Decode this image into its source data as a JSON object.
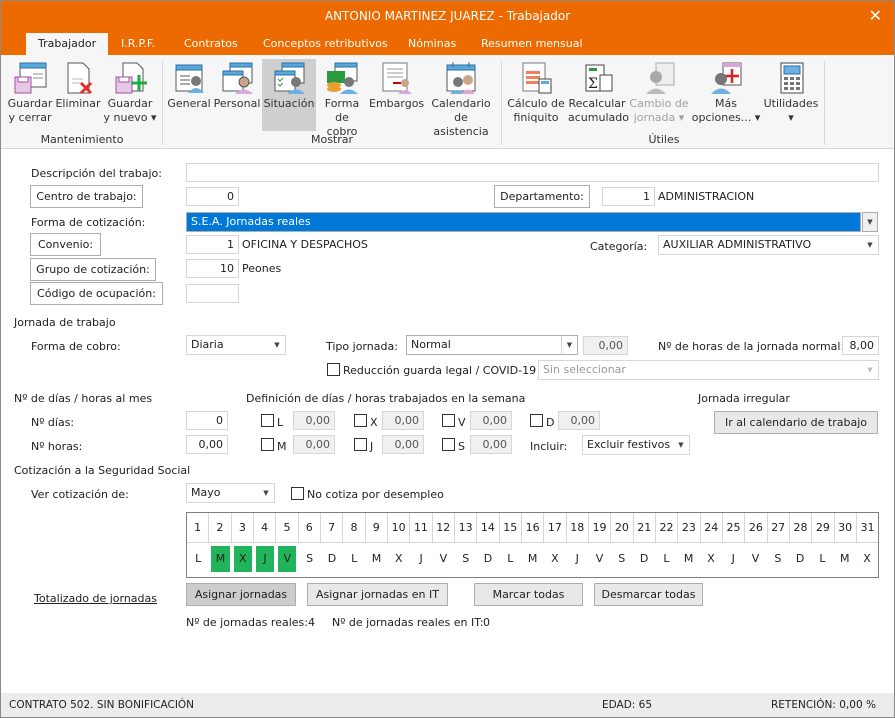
{
  "window": {
    "title": "ANTONIO MARTINEZ JUAREZ - Trabajador",
    "close_glyph": "✕"
  },
  "tabs": [
    {
      "label": "Trabajador",
      "active": true
    },
    {
      "label": "I.R.P.F."
    },
    {
      "label": "Contratos"
    },
    {
      "label": "Conceptos retributivos"
    },
    {
      "label": "Nóminas"
    },
    {
      "label": "Resumen mensual"
    }
  ],
  "ribbon": {
    "groups": {
      "mantenimiento": "Mantenimiento",
      "mostrar": "Mostrar",
      "utiles": "Útiles"
    },
    "buttons": {
      "guardar_cerrar": {
        "l1": "Guardar",
        "l2": "y cerrar",
        "icon": "save-close-icon"
      },
      "eliminar": {
        "l1": "Eliminar",
        "l2": "",
        "icon": "delete-icon"
      },
      "guardar_nuevo": {
        "l1": "Guardar",
        "l2": "y nuevo ▾",
        "icon": "save-new-icon"
      },
      "general": {
        "l1": "General",
        "l2": "",
        "icon": "general-icon"
      },
      "personal": {
        "l1": "Personal",
        "l2": "",
        "icon": "personal-icon"
      },
      "situacion": {
        "l1": "Situación",
        "l2": "",
        "icon": "situacion-icon",
        "selected": true
      },
      "forma_cobro": {
        "l1": "Forma",
        "l2": "de cobro",
        "icon": "payment-icon"
      },
      "embargos": {
        "l1": "Embargos",
        "l2": "",
        "icon": "embargos-icon"
      },
      "calendario": {
        "l1": "Calendario",
        "l2": "de asistencia",
        "icon": "calendar-icon"
      },
      "finiquito": {
        "l1": "Cálculo de",
        "l2": "finiquito",
        "icon": "finiquito-icon"
      },
      "recalcular": {
        "l1": "Recalcular",
        "l2": "acumulado",
        "icon": "sigma-icon"
      },
      "cambio_jornada": {
        "l1": "Cambio de",
        "l2": "jornada ▾",
        "icon": "cambio-jornada-icon",
        "disabled": true
      },
      "mas_opciones": {
        "l1": "Más",
        "l2": "opciones... ▾",
        "icon": "more-options-icon"
      },
      "utilidades": {
        "l1": "Utilidades",
        "l2": "▾",
        "icon": "calculator-icon"
      }
    }
  },
  "form": {
    "descripcion_label": "Descripción del trabajo:",
    "descripcion_value": "",
    "centro_btn": "Centro de trabajo:",
    "centro_value": "0",
    "departamento_btn": "Departamento:",
    "departamento_code": "1",
    "departamento_name": "ADMINISTRACION",
    "forma_cotizacion_label": "Forma de cotización:",
    "forma_cotizacion_value": "S.E.A. Jornadas reales",
    "convenio_btn": "Convenio:",
    "convenio_code": "1",
    "convenio_name": "OFICINA Y DESPACHOS",
    "categoria_label": "Categoría:",
    "categoria_value": "AUXILIAR ADMINISTRATIVO",
    "grupo_btn": "Grupo de cotización:",
    "grupo_code": "10",
    "grupo_name": "Peones",
    "codigo_btn": "Código de ocupación:",
    "codigo_value": ""
  },
  "jornada": {
    "section_title": "Jornada de trabajo",
    "forma_cobro_label": "Forma de cobro:",
    "forma_cobro_value": "Diaria",
    "tipo_label": "Tipo jornada:",
    "tipo_value": "Normal",
    "tipo_extra": "0,00",
    "horas_normal_label": "Nº de horas de la jornada normal:",
    "horas_normal_value": "8,00",
    "reduccion_label": "Reducción guarda legal / COVID-19",
    "reduccion_checked": false,
    "reduccion_select": "Sin seleccionar"
  },
  "dias_horas": {
    "section_title": "Nº de días / horas al mes",
    "dias_label": "Nº días:",
    "dias_value": "0",
    "horas_label": "Nº horas:",
    "horas_value": "0,00",
    "semana_title": "Definición de días / horas trabajados en la semana",
    "week": [
      {
        "day": "L",
        "value": "0,00",
        "checked": false
      },
      {
        "day": "M",
        "value": "0,00",
        "checked": false
      },
      {
        "day": "X",
        "value": "0,00",
        "checked": false
      },
      {
        "day": "J",
        "value": "0,00",
        "checked": false
      },
      {
        "day": "V",
        "value": "0,00",
        "checked": false
      },
      {
        "day": "S",
        "value": "0,00",
        "checked": false
      },
      {
        "day": "D",
        "value": "0,00",
        "checked": false
      }
    ],
    "incluir_label": "Incluir:",
    "incluir_value": "Excluir festivos",
    "irregular_title": "Jornada irregular",
    "irregular_btn": "Ir al calendario de trabajo"
  },
  "cotizacion": {
    "section_title": "Cotización a la Seguridad Social",
    "ver_label": "Ver cotización de:",
    "ver_value": "Mayo",
    "desempleo_label": "No cotiza por desempleo",
    "desempleo_checked": false,
    "days": [
      "1",
      "2",
      "3",
      "4",
      "5",
      "6",
      "7",
      "8",
      "9",
      "10",
      "11",
      "12",
      "13",
      "14",
      "15",
      "16",
      "17",
      "18",
      "19",
      "20",
      "21",
      "22",
      "23",
      "24",
      "25",
      "26",
      "27",
      "28",
      "29",
      "30",
      "31"
    ],
    "weekdays": [
      "L",
      "M",
      "X",
      "J",
      "V",
      "S",
      "D",
      "L",
      "M",
      "X",
      "J",
      "V",
      "S",
      "D",
      "L",
      "M",
      "X",
      "J",
      "V",
      "S",
      "D",
      "L",
      "M",
      "X",
      "J",
      "V",
      "S",
      "D",
      "L",
      "M",
      "X"
    ],
    "marked_days": [
      2,
      3,
      4,
      5
    ],
    "marked_color": "#21b45a",
    "totalizado_link": "Totalizado de jornadas",
    "buttons": {
      "asignar": "Asignar jornadas",
      "asignar_it": "Asignar jornadas en IT",
      "marcar": "Marcar todas",
      "desmarcar": "Desmarcar todas"
    },
    "reales_label": "Nº de jornadas reales:",
    "reales_value": "4",
    "reales_it_label": "Nº de jornadas reales en IT:",
    "reales_it_value": "0"
  },
  "status": {
    "contrato": "CONTRATO 502.  SIN BONIFICACIÓN",
    "edad": "EDAD: 65",
    "retencion": "RETENCIÓN: 0,00 %"
  },
  "colors": {
    "accent": "#ec6a00",
    "selection": "#0078d7"
  }
}
